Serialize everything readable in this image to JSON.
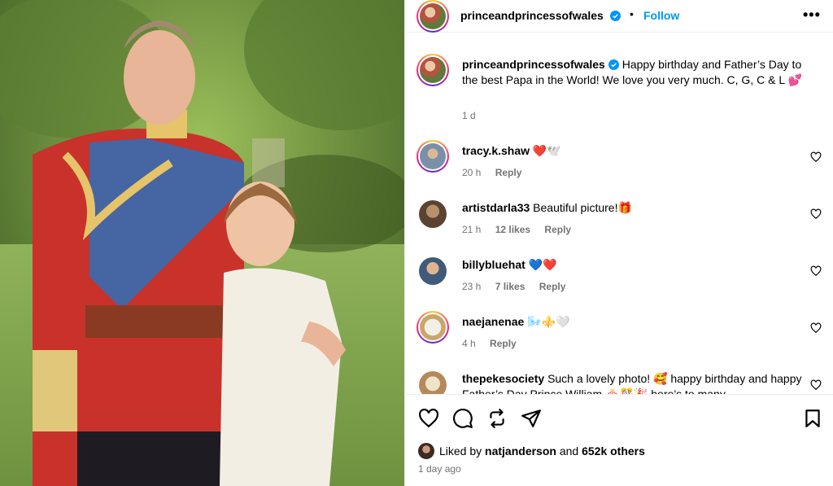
{
  "post": {
    "username": "princeandprincessofwales",
    "follow_label": "Follow",
    "separator": "•",
    "more_label": "•••",
    "caption": "Happy birthday and Father’s Day to the best Papa in the World! We love you very much. C, G, C & L 💕",
    "caption_time": "1 d"
  },
  "comments": [
    {
      "user": "tracy.k.shaw",
      "text": "❤️🕊️",
      "time": "20 h",
      "likes": "",
      "reply": "Reply"
    },
    {
      "user": "artistdarla33",
      "text": "Beautiful picture!🎁",
      "time": "21 h",
      "likes": "12 likes",
      "reply": "Reply"
    },
    {
      "user": "billybluehat",
      "text": "💙❤️",
      "time": "23 h",
      "likes": "7 likes",
      "reply": "Reply"
    },
    {
      "user": "naejanenae",
      "text": "🌬️⚜️🤍",
      "time": "4 h",
      "likes": "",
      "reply": "Reply"
    },
    {
      "user": "thepekesociety",
      "text": "Such a lovely photo! 🥰 happy birthday and happy Father’s Day Prince William 🎂🎊🎉 here’s to many",
      "time": "",
      "likes": "",
      "reply": ""
    }
  ],
  "footer": {
    "liked_prefix": "Liked by ",
    "liked_user": "natjanderson",
    "liked_and": " and ",
    "liked_count": "652k others",
    "time": "1 day ago"
  },
  "icons": {
    "verified": "verified-badge-icon",
    "like": "heart-icon",
    "comment": "comment-icon",
    "share": "repost-icon",
    "send": "send-icon",
    "save": "bookmark-icon"
  },
  "colors": {
    "accent": "#0095f6",
    "muted": "#737373",
    "verified": "#0095f6",
    "heart": "#ed4956"
  }
}
